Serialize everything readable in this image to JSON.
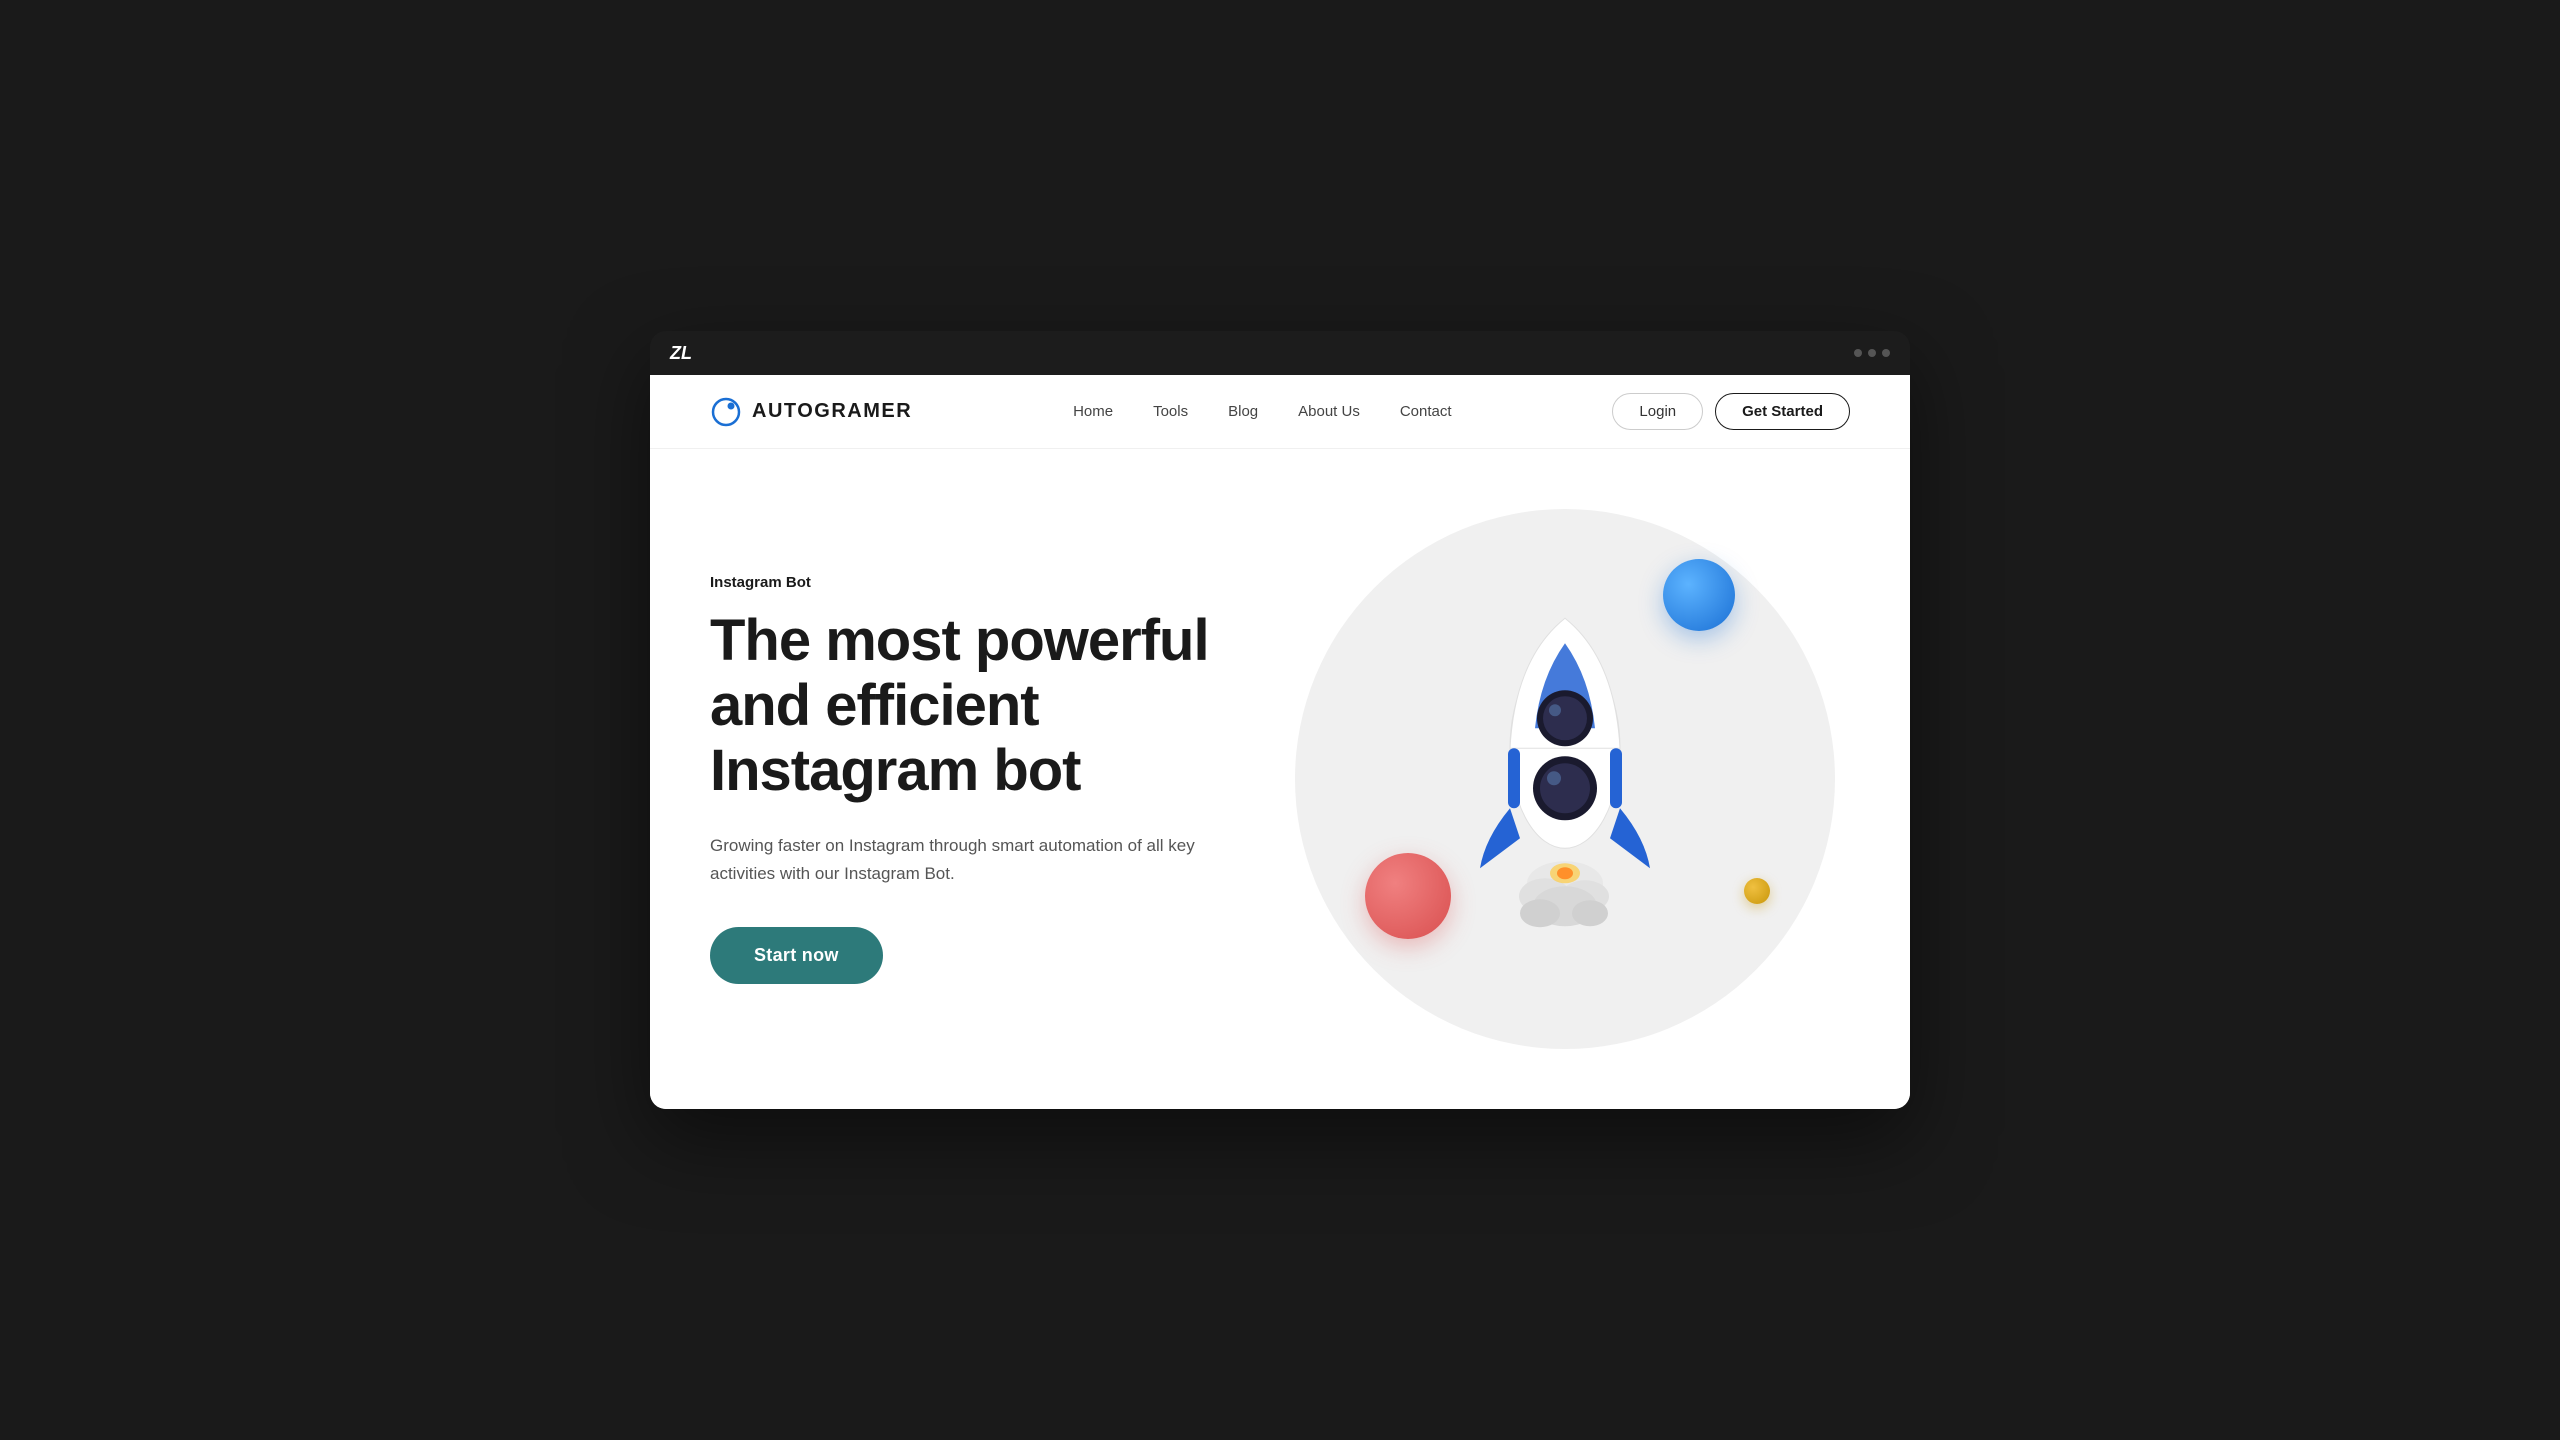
{
  "browser": {
    "logo": "ZL",
    "dots": 3
  },
  "navbar": {
    "logo_text": "AUTOGRAMER",
    "links": [
      {
        "label": "Home",
        "key": "home"
      },
      {
        "label": "Tools",
        "key": "tools"
      },
      {
        "label": "Blog",
        "key": "blog"
      },
      {
        "label": "About Us",
        "key": "about"
      },
      {
        "label": "Contact",
        "key": "contact"
      }
    ],
    "login_label": "Login",
    "get_started_label": "Get Started"
  },
  "hero": {
    "tag": "Instagram Bot",
    "title_line1": "The most powerful",
    "title_line2": "and efficient",
    "title_line3": "Instagram bot",
    "description": "Growing faster on Instagram through smart automation of all key activities with our Instagram Bot.",
    "cta_label": "Start now"
  },
  "colors": {
    "teal": "#2d7a7a",
    "blue_sphere": "#1a6fd4",
    "red_sphere": "#d94f4f",
    "gold_sphere": "#c8960a",
    "hero_circle_bg": "#f0f0f0"
  }
}
